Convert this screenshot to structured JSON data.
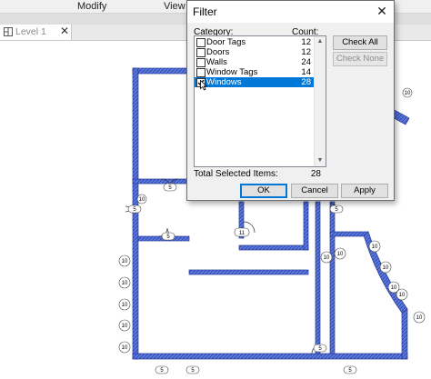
{
  "ribbon": {
    "tabs": [
      "Modify",
      "View"
    ]
  },
  "view_tab": {
    "label": "Level 1",
    "close_glyph": "✕"
  },
  "dialog": {
    "title": "Filter",
    "close_glyph": "✕",
    "category_header": "Category:",
    "count_header": "Count:",
    "items": [
      {
        "label": "Door Tags",
        "count": "12",
        "checked": false,
        "selected": false
      },
      {
        "label": "Doors",
        "count": "12",
        "checked": false,
        "selected": false
      },
      {
        "label": "Walls",
        "count": "24",
        "checked": false,
        "selected": false
      },
      {
        "label": "Window Tags",
        "count": "14",
        "checked": false,
        "selected": false
      },
      {
        "label": "Windows",
        "count": "28",
        "checked": true,
        "selected": true
      }
    ],
    "check_all_label": "Check All",
    "check_none_label": "Check None",
    "total_label": "Total Selected Items:",
    "total_value": "28",
    "ok_label": "OK",
    "cancel_label": "Cancel",
    "apply_label": "Apply"
  },
  "plan": {
    "wall_color": "#3f5fcf",
    "door_tags": [
      "5",
      "5",
      "5",
      "5",
      "5",
      "5",
      "5",
      "5"
    ],
    "window_tags": [
      "10",
      "10",
      "10",
      "10",
      "10",
      "10",
      "10",
      "10",
      "10",
      "10",
      "10",
      "10",
      "10",
      "10"
    ],
    "room_tag": "11"
  },
  "colors": {
    "selection": "#0078d7",
    "wall": "#3f5fcf",
    "dialog_bg": "#f0f0f0"
  }
}
